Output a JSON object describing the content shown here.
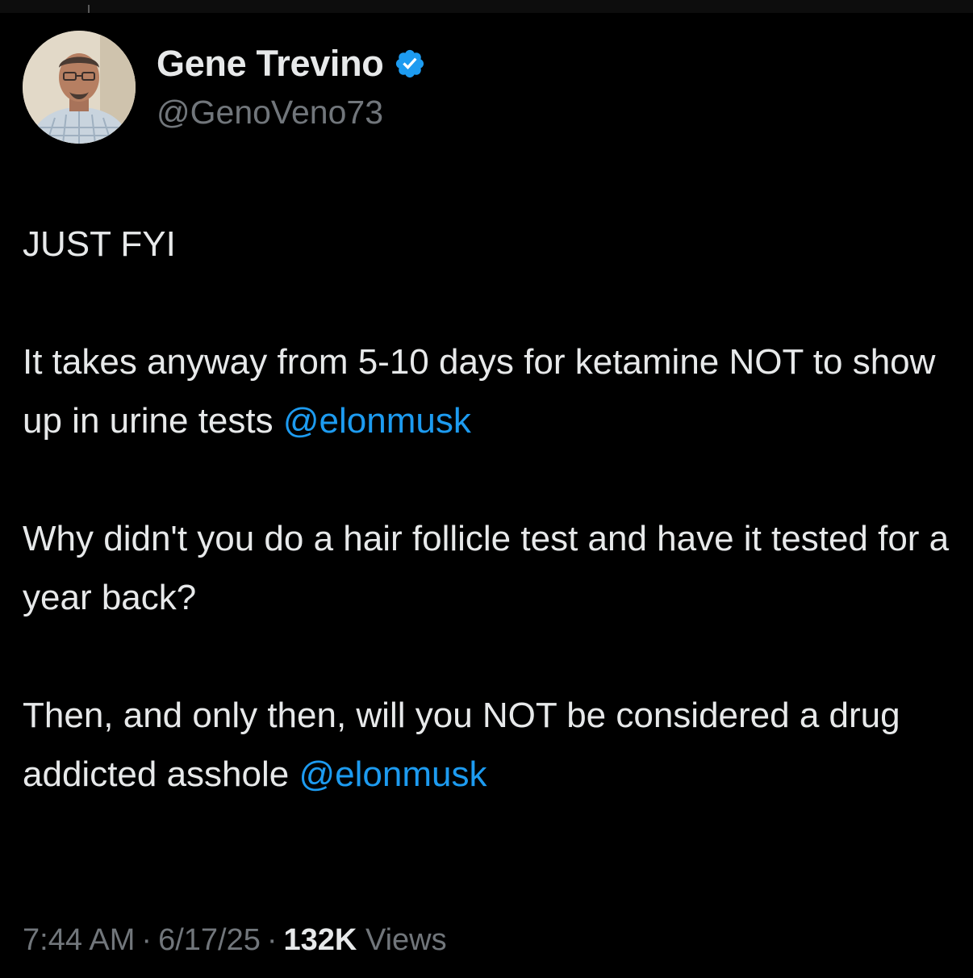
{
  "author": {
    "display_name": "Gene Trevino",
    "handle": "@GenoVeno73",
    "verified": true,
    "verified_color": "#1d9bf0"
  },
  "tweet": {
    "line1": "JUST FYI",
    "para2_text": "It takes anyway from 5-10 days for ketamine NOT to show up in urine tests ",
    "para2_mention": "@elonmusk",
    "para3_text": "Why didn't you do a hair follicle test and have it tested for a year back?",
    "para4_text": "Then, and only then, will you NOT be considered a drug addicted asshole ",
    "para4_mention": "@elonmusk"
  },
  "meta": {
    "time": "7:44 AM",
    "separator": "·",
    "date": "6/17/25",
    "views_count": "132K",
    "views_label": "Views"
  },
  "colors": {
    "background": "#000000",
    "text": "#e7e9ea",
    "secondary": "#71767b",
    "link": "#1d9bf0"
  },
  "icons": {
    "verified": "verified-badge-icon"
  }
}
